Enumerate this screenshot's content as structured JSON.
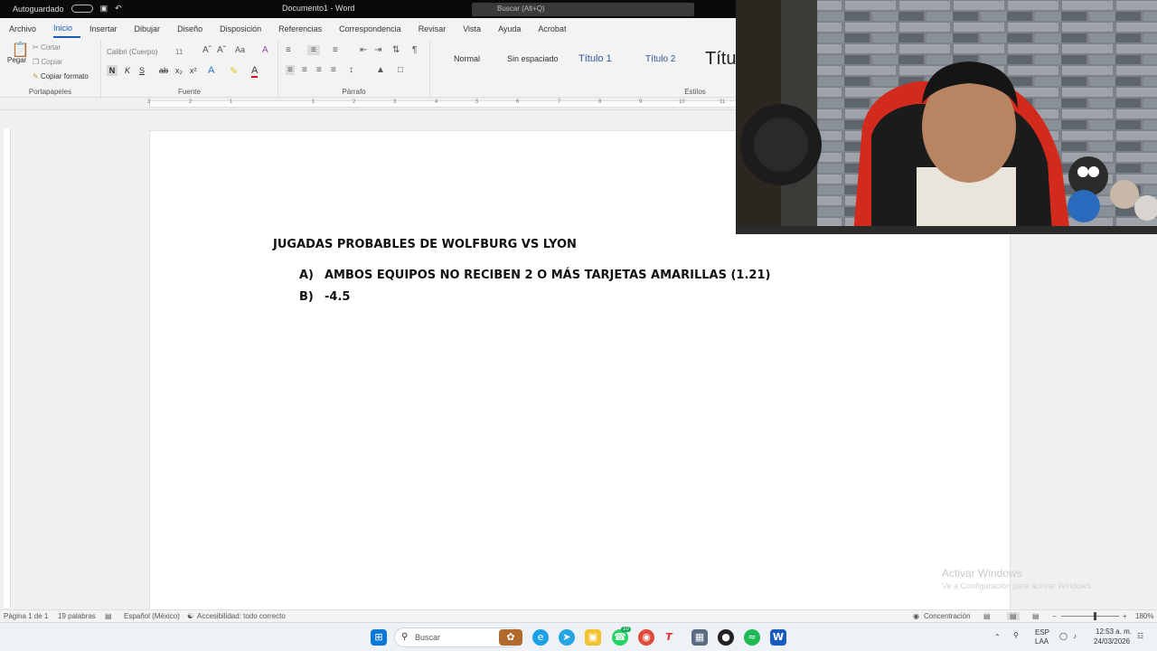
{
  "titlebar": {
    "autosave": "Autoguardado",
    "title": "Documento1 - Word",
    "search": "Buscar (Alt+Q)"
  },
  "tabs": [
    "Archivo",
    "Inicio",
    "Insertar",
    "Dibujar",
    "Diseño",
    "Disposición",
    "Referencias",
    "Correspondencia",
    "Revisar",
    "Vista",
    "Ayuda",
    "Acrobat"
  ],
  "ribbon": {
    "clipboard": {
      "paste": "Pegar",
      "cut": "Cortar",
      "copy": "Copiar",
      "format_painter": "Copiar formato",
      "label": "Portapapeles"
    },
    "font": {
      "name": "Calibri (Cuerpo)",
      "size": "11",
      "label": "Fuente"
    },
    "paragraph": {
      "label": "Párrafo"
    },
    "styles": {
      "items": [
        "Normal",
        "Sin espaciado",
        "Título 1",
        "Título 2",
        "Títu"
      ],
      "label": "Estilos"
    }
  },
  "ruler": {
    "numbers": [
      "3",
      "2",
      "1",
      "1",
      "2",
      "3",
      "4",
      "5",
      "6",
      "7",
      "8",
      "9",
      "10",
      "11"
    ]
  },
  "document": {
    "title": "JUGADAS PROBABLES DE WOLFBURG VS LYON",
    "items": [
      {
        "letter": "A)",
        "text": "AMBOS EQUIPOS NO RECIBEN 2 O MÁS TARJETAS AMARILLAS (1.21)"
      },
      {
        "letter": "B)",
        "text": "-4.5"
      }
    ]
  },
  "watermark": {
    "line1": "Activar Windows",
    "line2": "Ve a Configuración para activar Windows."
  },
  "statusbar": {
    "page": "Página 1 de 1",
    "words": "19 palabras",
    "language": "Español (México)",
    "accessibility": "Accesibilidad: todo correcto",
    "focus": "Concentración",
    "zoom": "180%"
  },
  "taskbar": {
    "search": "Buscar",
    "badge": "10",
    "lang_top": "ESP",
    "lang_bottom": "LAA",
    "time": "12:53 a. m.",
    "date": "24/03/2026"
  },
  "colors": {
    "word_blue": "#185abd",
    "taskbar": "#eef1f6"
  }
}
